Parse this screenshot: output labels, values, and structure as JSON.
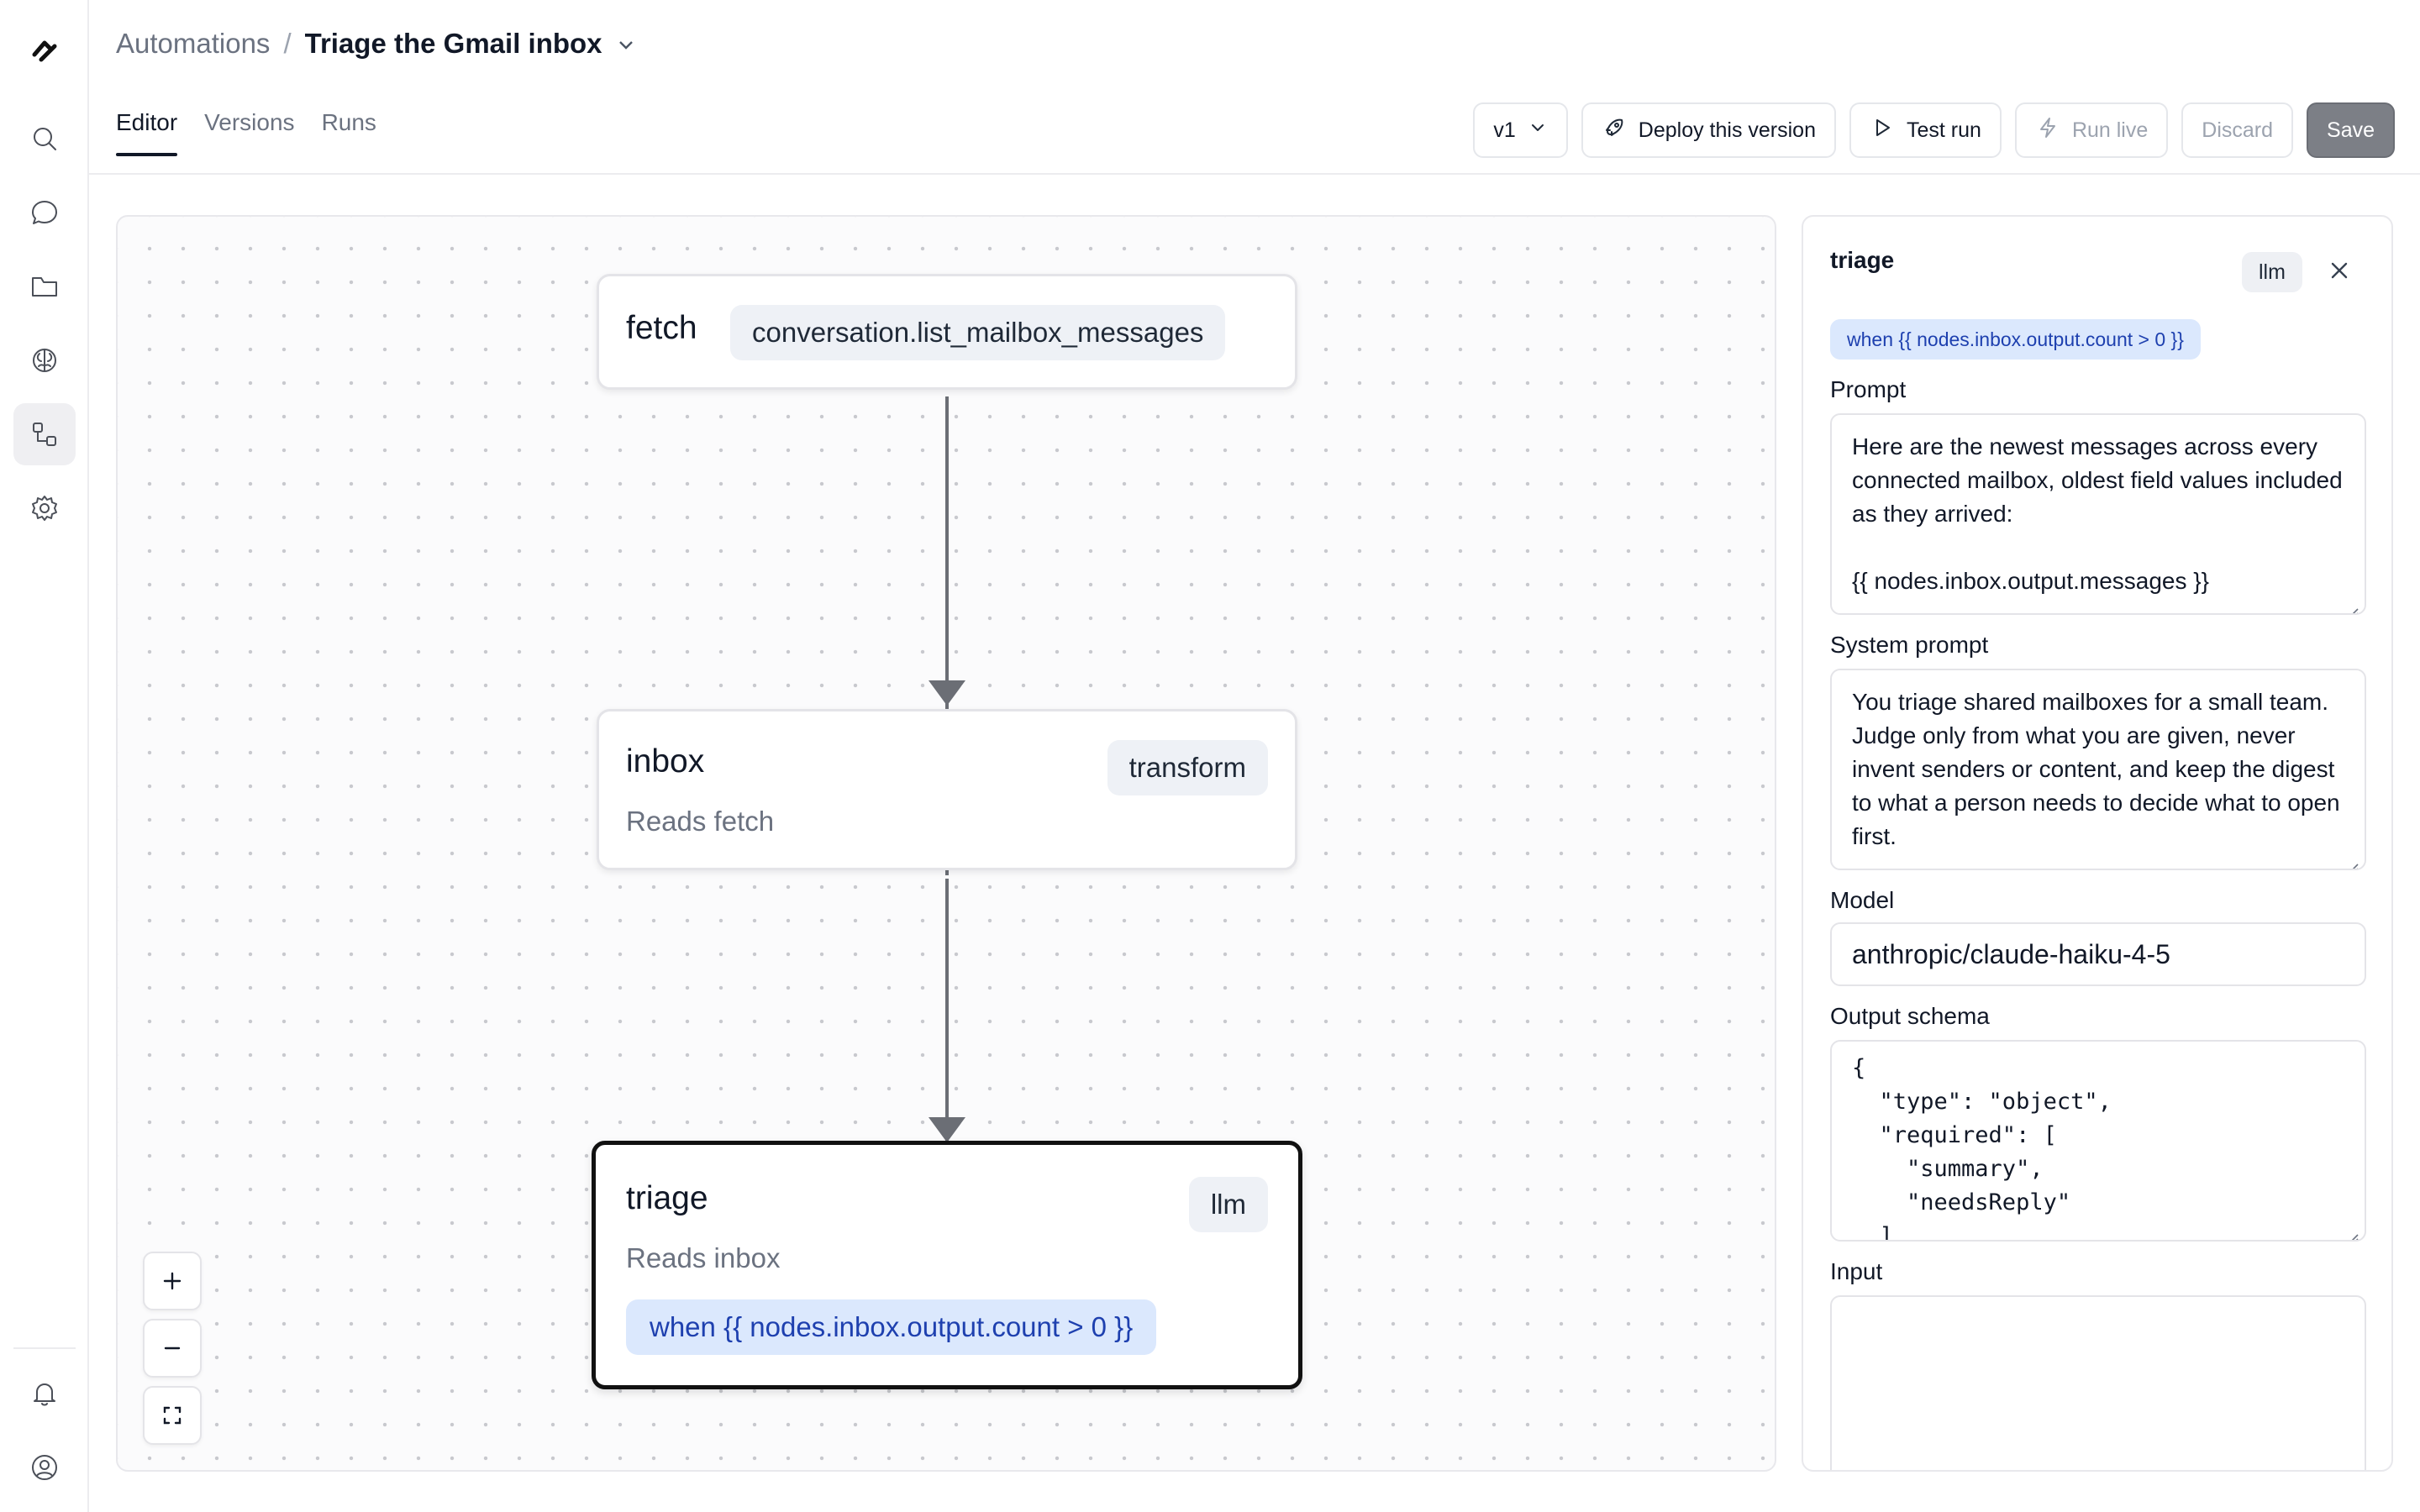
{
  "breadcrumb": {
    "root": "Automations",
    "separator": "/",
    "current": "Triage the Gmail inbox"
  },
  "tabs": [
    {
      "label": "Editor",
      "active": true
    },
    {
      "label": "Versions",
      "active": false
    },
    {
      "label": "Runs",
      "active": false
    }
  ],
  "toolbar": {
    "version": "v1",
    "deploy": "Deploy this version",
    "test_run": "Test run",
    "run_live": "Run live",
    "discard": "Discard",
    "save": "Save"
  },
  "rail": {
    "top_icons": [
      "logo-icon",
      "search-icon",
      "chat-icon",
      "folder-icon",
      "brain-icon",
      "workflow-icon",
      "gear-icon"
    ],
    "active": "workflow-icon",
    "bottom_icons": [
      "bell-icon",
      "user-circle-icon"
    ]
  },
  "nodes": [
    {
      "id": "fetch",
      "title": "fetch",
      "tag": "conversation.list_mailbox_messages"
    },
    {
      "id": "inbox",
      "title": "inbox",
      "tag": "transform",
      "subtitle": "Reads fetch"
    },
    {
      "id": "triage",
      "title": "triage",
      "tag": "llm",
      "subtitle": "Reads inbox",
      "condition": "when {{ nodes.inbox.output.count > 0 }}",
      "selected": true
    }
  ],
  "zoom_controls": {
    "zoom_in": "+",
    "zoom_out": "−"
  },
  "panel": {
    "title": "triage",
    "kind": "llm",
    "condition": "when {{ nodes.inbox.output.count > 0 }}",
    "prompt_label": "Prompt",
    "prompt_line1": "Here are the newest messages across every connected mailbox, oldest field values included as they arrived:",
    "prompt_line2": "{{ nodes.inbox.output.messages }}",
    "system_prompt_label": "System prompt",
    "system_prompt": "You triage shared mailboxes for a small team. Judge only from what you are given, never invent senders or content, and keep the digest to what a person needs to decide what to open first.",
    "model_label": "Model",
    "model": "anthropic/claude-haiku-4-5",
    "output_schema_label": "Output schema",
    "output_schema": "{\n  \"type\": \"object\",\n  \"required\": [\n    \"summary\",\n    \"needsReply\"\n  ]\n}",
    "input_label": "Input",
    "input": ""
  },
  "colors": {
    "accent_pill_bg": "#dbe8fd",
    "accent_pill_text": "#1e40af",
    "save_bg": "#7c7f86"
  }
}
